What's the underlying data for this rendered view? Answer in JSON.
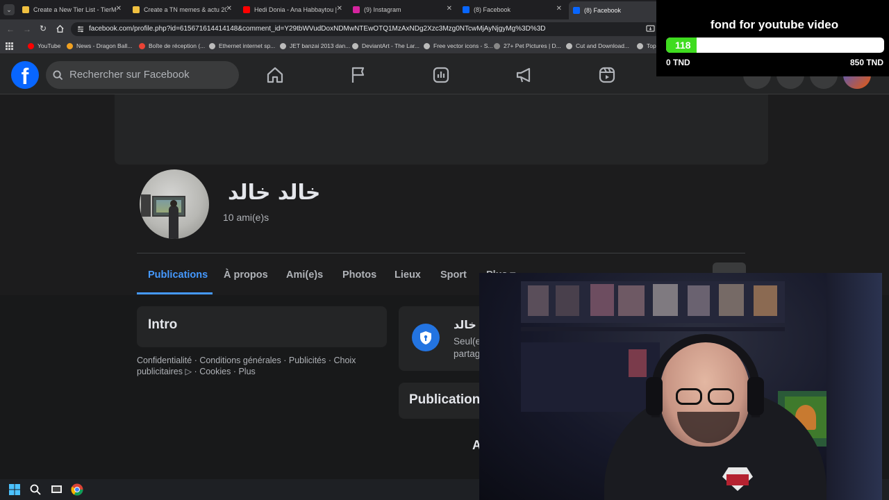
{
  "browser": {
    "tabs": [
      {
        "title": "Create a New Tier List - TierMa",
        "favicon_color": "#f0c040"
      },
      {
        "title": "Create a TN memes & actu 202",
        "favicon_color": "#f0c040"
      },
      {
        "title": "Hedi Donia - Ana Habbaytou |",
        "favicon_color": "#ff0000"
      },
      {
        "title": "(9) Instagram",
        "favicon_color": "#d6249f"
      },
      {
        "title": "(8) Facebook",
        "favicon_color": "#0866ff"
      },
      {
        "title": "(8) Facebook",
        "favicon_color": "#0866ff"
      }
    ],
    "url": "facebook.com/profile.php?id=615671614414148&comment_id=Y29tbWVudDoxNDMwNTEwOTQ1MzAxNDg2Xzc3Mzg0NTcwMjAyNjgyMg%3D%3D",
    "bookmarks": [
      "YouTube",
      "News - Dragon Ball...",
      "Boîte de réception (...",
      "Ethernet internet sp...",
      "JET banzai 2013 dan...",
      "DeviantArt - The Lar...",
      "Free vector icons - S...",
      "27+ Pet Pictures | D...",
      "Cut and Download...",
      "Top"
    ]
  },
  "facebook": {
    "logo_letter": "f",
    "search_placeholder": "Rechercher sur Facebook",
    "nav_icons": [
      "home-icon",
      "flag-icon",
      "dashboard-icon",
      "megaphone-icon",
      "reels-icon"
    ],
    "profile": {
      "name": "خالد خالد",
      "friends": "10 ami(e)s"
    },
    "tabs": [
      "Publications",
      "À propos",
      "Ami(e)s",
      "Photos",
      "Lieux",
      "Sport",
      "Plus ▾"
    ],
    "active_tab": "Publications",
    "intro_title": "Intro",
    "footer_links": "Confidentialité · Conditions générales · Publicités · Choix publicitaires ▷ · Cookies · Plus",
    "privacy_card": {
      "name": "خالد خالد",
      "line1": "Seul(e)",
      "line2": "partag"
    },
    "posts_title": "Publication",
    "posts_hint": "A"
  },
  "donation": {
    "title": "fond for youtube video",
    "current": "118",
    "min_label": "0 TND",
    "max_label": "850 TND",
    "progress": 0.139,
    "fill_color": "#3fdc1f"
  }
}
